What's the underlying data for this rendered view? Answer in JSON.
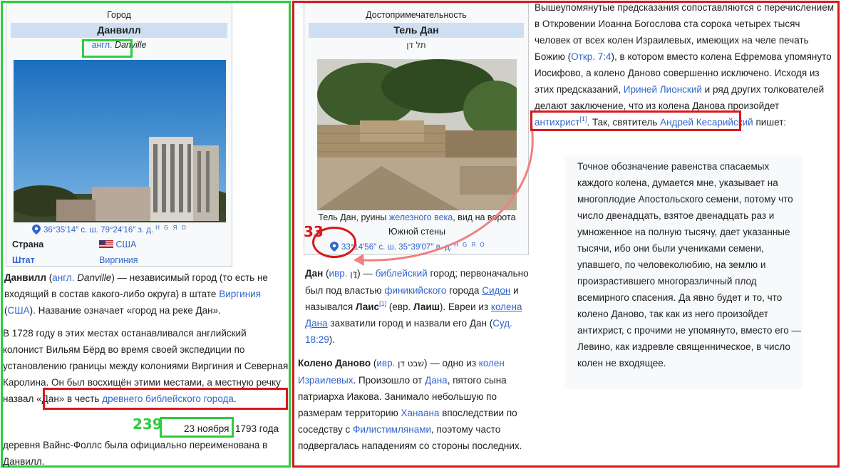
{
  "left_infobox": {
    "type": "Город",
    "title": "Данвилл",
    "subtitle_lang": "англ.",
    "subtitle_name": "Danville",
    "coord_lat": "36°35′14″ с. ш.",
    "coord_lon": "79°24′16″ з. д.",
    "coord_tools": "H G Я O",
    "country_label": "Страна",
    "country_value": "США",
    "state_label": "Штат",
    "state_value": "Виргиния"
  },
  "left_text": {
    "p1_bold": "Данвилл",
    "p1_open": "(",
    "p1_lang": "англ.",
    "p1_name": "Danville",
    "p1_a": ") — независимый город (то есть не входящий в состав какого-либо округа) в штате",
    "p1_state": "Виргиния",
    "p1_b": "(",
    "p1_usa": "США",
    "p1_c": "). Название означает «город на реке Дан».",
    "p2_a": "В 1728 году в этих местах останавливался английский колонист Вильям Бёрд во время своей экспедиции по установлению границы между колониями Виргиния и Северная Каролина. Он был восхищён этими местами, а местную речку назвал «Дан» в честь",
    "p2_link": "древнего библейского города",
    "p2_end": ".",
    "p3_date": "23 ноября",
    "p3_a": "1793 года деревня Вайнс-Фоллс была официально переименована в Данвилл."
  },
  "right_infobox": {
    "type": "Достопримечательность",
    "title": "Тель Дан",
    "hebrew": "תל דן",
    "caption_a": "Тель Дан, руины",
    "caption_link": "железного века",
    "caption_b": ", вид на ворота Южной стены",
    "coord_lat": "33°14′56″ с. ш.",
    "coord_lon": "35°39′07″ в. д.",
    "coord_tools": "H G Я O"
  },
  "middle_text": {
    "p1_bold": "Дан",
    "p1_lang": "ивр.",
    "p1_heb": "דָּן",
    "p1_a": "—",
    "p1_bib": "библейский",
    "p1_b": "город; первоначально был под властью",
    "p1_phoen": "финикийского",
    "p1_c": "города",
    "p1_sidon": "Сидон",
    "p1_d": "и назывался",
    "p1_lais": "Лаис",
    "p1_ref": "[1]",
    "p1_e": "(евр.",
    "p1_laish": "Лаиш",
    "p1_f": "). Евреи из",
    "p1_tribe": "колена Дана",
    "p1_g": "захватили город и назвали его Дан (",
    "p1_judg": "Суд. 18:29",
    "p1_h": ").",
    "p2_bold": "Колено Даново",
    "p2_lang": "ивр.",
    "p2_heb": "שבט דן",
    "p2_a": "— одно из",
    "p2_tribes": "колен Израилевых",
    "p2_b": ". Произошло от",
    "p2_dan": "Дана",
    "p2_c": ", пятого сына патриарха Иакова. Занимало небольшую по размерам территорию",
    "p2_canaan": "Ханаана",
    "p2_d": "впоследствии по соседству с",
    "p2_phil": "Филистимлянами",
    "p2_e": ", поэтому часто подвергалась нападениям со стороны последних."
  },
  "right_text": {
    "p1_a": "Вышеупомянутые предсказания сопоставляются с перечислением в Откровении Иоанна Богослова ста сорока четырех тысяч человек от всех колен Израилевых, имеющих на челе печать Божию (",
    "p1_rev": "Откр. 7:4",
    "p1_b": "), в котором вместо колена Ефремова упомянуто Иосифово, а колено Даново совершенно исключено. Исходя из этих предсказаний,",
    "p1_iren": "Ириней Лионский",
    "p1_c": "и ряд других толкователей делают заключение, что из колена Данова произойдет",
    "p1_anti": "антихрист",
    "p1_ref": "[1]",
    "p1_d": ". Так, святитель",
    "p1_andr": "Андрей Кесарийский",
    "p1_e": "пишет:",
    "quote": "Точное обозначение равенства спасаемых каждого колена, думается мне, указывает на многоплодие Апостольского семени, потому что число двенадцать, взятое двенадцать раз и умноженное на полную тысячу, дает указанные тысячи, ибо они были учениками семени, упавшего, по человеколюбию, на землю и произрастившего многоразличный плод всемирного спасения. Да явно будет и то, что колено Даново, так как из него произойдет антихрист, с прочими не упомянуто, вместо его — Левино, как издревле священническое, в число колен не входящее."
  },
  "annotations": {
    "green_num": "239",
    "red_num": "33"
  },
  "colors": {
    "green": "#2ecc40",
    "red": "#d7191c",
    "link": "#3366cc",
    "arrow": "#f08080"
  }
}
